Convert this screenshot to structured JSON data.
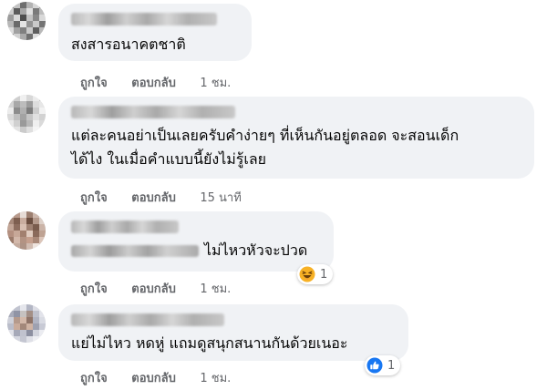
{
  "comments": [
    {
      "text_lines": [
        "สงสารอนาคตชาติ"
      ],
      "like_label": "ถูกใจ",
      "reply_label": "ตอบกลับ",
      "time": "1 ชม."
    },
    {
      "text_lines": [
        "แต่ละคนอย่าเป็นเลยครับคำง่ายๆ ที่เห็นกันอยู่ตลอด จะสอนเด็ก",
        "ได้ไง ในเมื่อคำแบบนี้ยังไม่รู้เลย"
      ],
      "like_label": "ถูกใจ",
      "reply_label": "ตอบกลับ",
      "time": "15 นาที"
    },
    {
      "text_lines": [
        "ไม่ไหวหัวจะปวด"
      ],
      "like_label": "ถูกใจ",
      "reply_label": "ตอบกลับ",
      "time": "1 ชม.",
      "reaction": {
        "icon": "haha-icon",
        "count": "1",
        "color": "#f7b125"
      }
    },
    {
      "text_lines": [
        "แย่ไม่ไหว หดหู่ แถมดูสนุกสนานกันด้วยเนอะ"
      ],
      "like_label": "ถูกใจ",
      "reply_label": "ตอบกลับ",
      "time": "1 ชม.",
      "reaction": {
        "icon": "like-icon",
        "count": "1",
        "color": "#1877f2"
      }
    }
  ]
}
